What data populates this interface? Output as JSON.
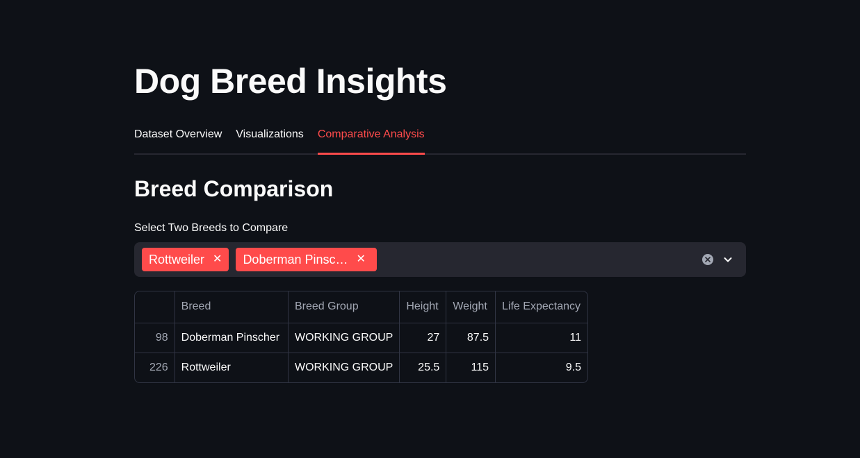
{
  "header": {
    "title": "Dog Breed Insights"
  },
  "tabs": [
    {
      "label": "Dataset Overview",
      "active": false
    },
    {
      "label": "Visualizations",
      "active": false
    },
    {
      "label": "Comparative Analysis",
      "active": true
    }
  ],
  "section": {
    "title": "Breed Comparison"
  },
  "breed_select": {
    "label": "Select Two Breeds to Compare",
    "selected": [
      {
        "label": "Rottweiler"
      },
      {
        "label": "Doberman Pinsc…"
      }
    ],
    "clear_icon": "clear-icon",
    "dropdown_icon": "chevron-down-icon"
  },
  "table": {
    "columns": [
      "",
      "Breed",
      "Breed Group",
      "Height",
      "Weight",
      "Life Expectancy"
    ],
    "rows": [
      {
        "index": "98",
        "breed": "Doberman Pinscher",
        "group": "WORKING GROUP",
        "height": "27",
        "weight": "87.5",
        "life": "11"
      },
      {
        "index": "226",
        "breed": "Rottweiler",
        "group": "WORKING GROUP",
        "height": "25.5",
        "weight": "115",
        "life": "9.5"
      }
    ]
  },
  "colors": {
    "background": "#0e1117",
    "accent": "#ff4b4b",
    "input_bg": "#262730",
    "muted_text": "#a3a8b4"
  }
}
